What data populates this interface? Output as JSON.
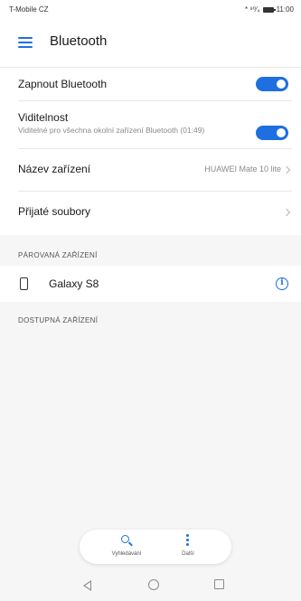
{
  "status_bar": {
    "carrier": "T-Mobile CZ",
    "icons": "* ⁹⁰⁄₄",
    "time": "11:00"
  },
  "header": {
    "title": "Bluetooth",
    "menu_icon": "menu-icon"
  },
  "settings": {
    "bluetooth_toggle": {
      "label": "Zapnout Bluetooth",
      "enabled": true
    },
    "visibility": {
      "label": "Viditelnost",
      "subtitle": "Viditelné pro všechna okolní zařízení Bluetooth (01:49)",
      "enabled": true
    },
    "device_name": {
      "label": "Název zařízení",
      "value": "HUAWEI Mate 10 lite"
    },
    "received_files": {
      "label": "Přijaté soubory"
    }
  },
  "paired_section": {
    "header": "PÁROVANÁ ZAŘÍZENÍ",
    "devices": [
      {
        "name": "Galaxy S8",
        "icon": "phone-icon",
        "action_icon": "info-icon"
      }
    ]
  },
  "available_section": {
    "header": "DOSTUPNÁ ZAŘÍZENÍ"
  },
  "action_bar": {
    "search_label": "Vyhledávání",
    "more_label": "Další"
  },
  "colors": {
    "accent": "#1e6fe0",
    "background": "#f6f6f6"
  }
}
